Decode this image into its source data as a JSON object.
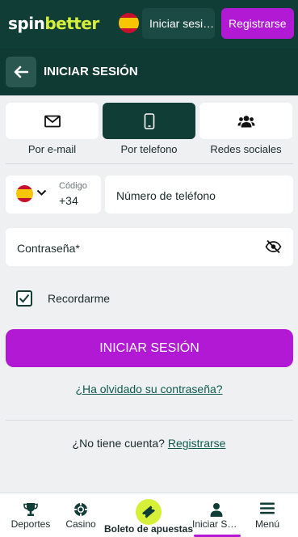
{
  "header": {
    "logo_part1": "spin",
    "logo_part2": "better",
    "language_flag": "spain-flag",
    "login_label": "Iniciar sesión",
    "register_label": "Registrarse",
    "colors": {
      "header_bg": "#103d36",
      "accent_purple": "#b219d4",
      "accent_lime": "#d6f03a"
    }
  },
  "titlebar": {
    "back_icon": "arrow-left-icon",
    "title": "INICIAR SESIÓN"
  },
  "login_methods": [
    {
      "label": "Por e-mail",
      "icon": "envelope-icon",
      "active": false
    },
    {
      "label": "Por telefono",
      "icon": "mobile-phone-icon",
      "active": true
    },
    {
      "label": "Redes sociales",
      "icon": "users-icon",
      "active": false
    }
  ],
  "form": {
    "country_code_label": "Código",
    "country_code_value": "+34",
    "phone_placeholder": "Número de teléfono",
    "password_placeholder": "Contraseña*",
    "remember_label": "Recordarme",
    "remember_checked": true,
    "submit_label": "INICIAR SESIÓN",
    "forgot_label": "¿Ha olvidado su contraseña?",
    "no_account_text": "¿No tiene cuenta?",
    "register_link": "Registrarse"
  },
  "bottom_nav": [
    {
      "label": "Deportes",
      "icon": "trophy-icon"
    },
    {
      "label": "Casino",
      "icon": "casino-chip-icon"
    },
    {
      "label": "Boleto de apuestas",
      "icon": "ticket-icon"
    },
    {
      "label": "Iniciar Sesión",
      "icon": "user-icon",
      "active": true
    },
    {
      "label": "Menú",
      "icon": "hamburger-menu-icon"
    }
  ]
}
